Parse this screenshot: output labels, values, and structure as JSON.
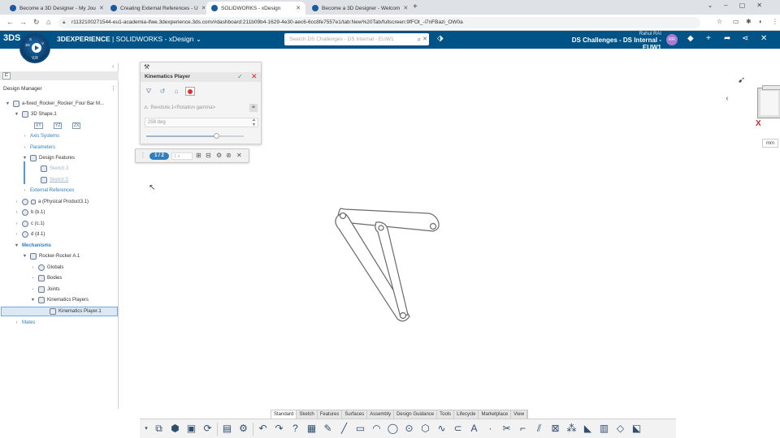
{
  "browser": {
    "tabs": [
      {
        "title": "Become a 3D Designer - My Jou"
      },
      {
        "title": "Creating External References - U"
      },
      {
        "title": "SOLIDWORKS - xDesign"
      },
      {
        "title": "Become a 3D Designer - Welcom"
      }
    ],
    "active_tab": 2,
    "url": "r1132100271544-eu1-academia-ifwe.3dexperience.3ds.com/#dashboard:211b09b4-1629-4e30-aec6-6cc8fe7557e1/tab:New%20Tab/fullscreen:9fFOt_-i7nFBazi_OW0a"
  },
  "app": {
    "brand_bold": "3DEXPERIENCE",
    "brand_sep": " | ",
    "app_name": "SOLIDWORKS - xDesign",
    "compass_label": "V,R",
    "compass_quadrants": [
      "3D",
      "V",
      "S"
    ],
    "search_placeholder": "Search DS Challenges - DS Internal - EUW1",
    "user_name": "Rahul RAI",
    "context": "DS Challenges - DS Internal - EUW1",
    "avatar_initials": "RR"
  },
  "panel": {
    "title": "Design Manager",
    "tree": [
      {
        "label": "a-fixed_Rocker_Rocker_Four Bar M...",
        "arrow": "▼",
        "icon": "part"
      },
      {
        "label": "3D Shape.1",
        "arrow": "▼",
        "icon": "shape"
      },
      {
        "label": "XY",
        "icon": "plane"
      },
      {
        "label": "YZ",
        "icon": "plane"
      },
      {
        "label": "ZX",
        "icon": "plane"
      },
      {
        "label": "Axis Systems",
        "arrow": "›"
      },
      {
        "label": "Parameters",
        "arrow": "›"
      },
      {
        "label": "Design Features",
        "arrow": "▼"
      },
      {
        "label": "Sketch.3"
      },
      {
        "label": "Sketch.5"
      },
      {
        "label": "External References",
        "arrow": "›"
      },
      {
        "label": "a (Physical Product3.1)",
        "arrow": "›"
      },
      {
        "label": "b (b.1)",
        "arrow": "›"
      },
      {
        "label": "c (c.1)",
        "arrow": "›"
      },
      {
        "label": "d (d.1)",
        "arrow": "›"
      },
      {
        "label": "Mechanisms",
        "arrow": "▼"
      },
      {
        "label": "Rocker-Rocker A.1",
        "arrow": "▼"
      },
      {
        "label": "Globals",
        "arrow": "›"
      },
      {
        "label": "Bodies",
        "arrow": "›"
      },
      {
        "label": "Joints",
        "arrow": "›"
      },
      {
        "label": "Kinematics Players",
        "arrow": "▼"
      },
      {
        "label": "Kinematics Player.1"
      },
      {
        "label": "Mates",
        "arrow": "›"
      }
    ]
  },
  "kinematics_player": {
    "title": "Kinematics Player",
    "command": "Revolute.1<Rotation gamma>",
    "value": "258 deg",
    "slider_fraction": 0.72,
    "frame": "1 / 2",
    "speed": "1 s"
  },
  "canvas": {
    "units": "mm",
    "axis_label": "X"
  },
  "action_bar": {
    "tabs": [
      "Standard",
      "Sketch",
      "Features",
      "Surfaces",
      "Assembly",
      "Design Guidance",
      "Tools",
      "Lifecycle",
      "Marketplace",
      "View"
    ],
    "active_tab": 0,
    "more": "▾"
  },
  "colors": {
    "topbar": "#005386",
    "accent": "#2f7fc1",
    "ok": "#3aa03a",
    "cancel": "#dd2222"
  }
}
